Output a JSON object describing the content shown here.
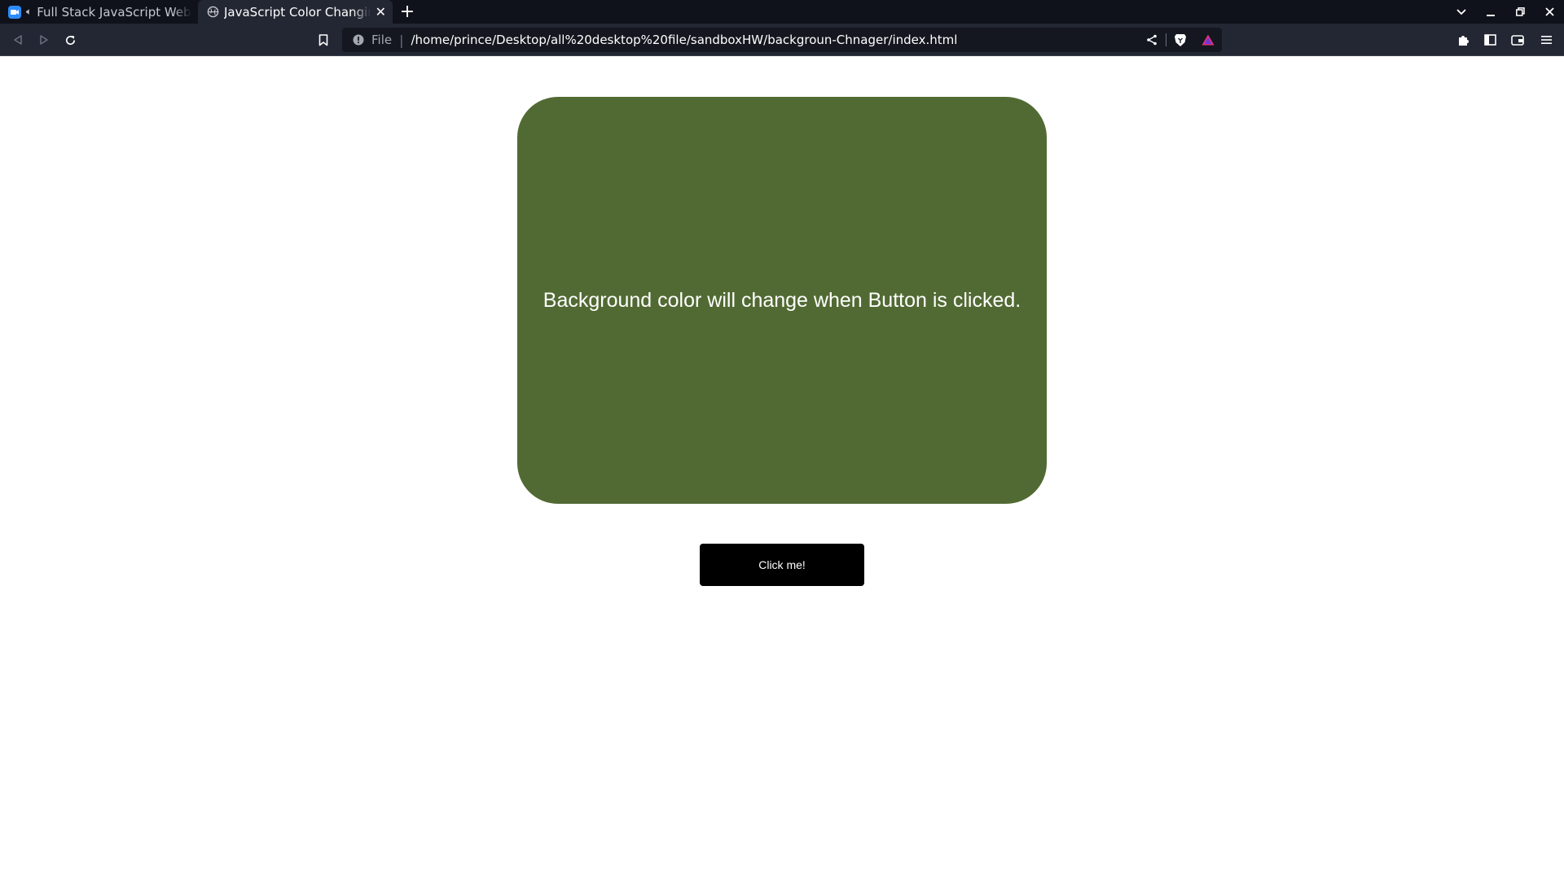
{
  "browser": {
    "tabs": [
      {
        "title": "Full Stack JavaScript Web Developer",
        "active": false,
        "audio": true
      },
      {
        "title": "JavaScript Color Changing Background",
        "active": true,
        "audio": false
      }
    ],
    "address": {
      "scheme_label": "File",
      "url": "/home/prince/Desktop/all%20desktop%20file/sandboxHW/backgroun-Chnager/index.html"
    }
  },
  "page": {
    "box_text": "Background color will change when Button is clicked.",
    "box_color": "#516a33",
    "button_label": "Click me!"
  },
  "colors": {
    "tabstrip_bg": "#0f121a",
    "toolbar_bg": "#232733",
    "urlbar_bg": "#14171f",
    "button_bg": "#000000"
  }
}
